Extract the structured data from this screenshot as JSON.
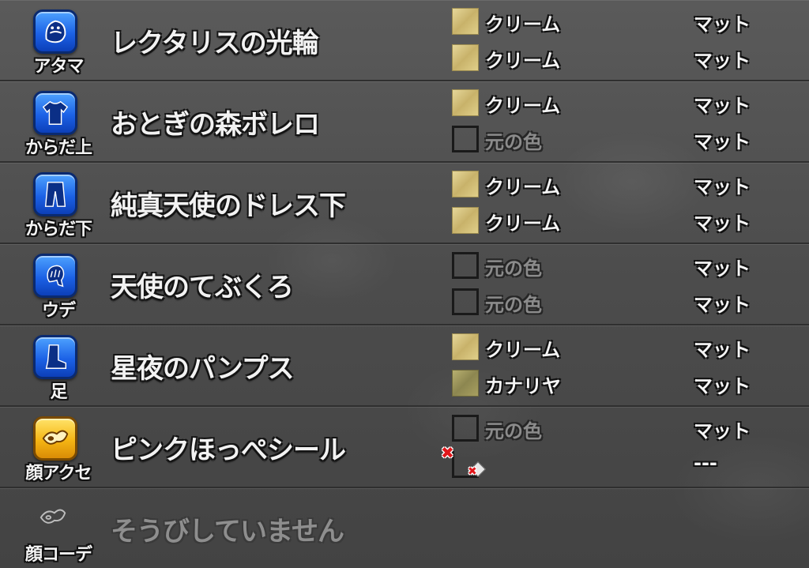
{
  "rows": [
    {
      "slot_label": "アタマ",
      "slot_icon": "helmet-icon",
      "item_name": "レクタリスの光輪",
      "dyes": [
        {
          "swatch": "cream",
          "color": "クリーム",
          "finish": "マット"
        },
        {
          "swatch": "cream",
          "color": "クリーム",
          "finish": "マット"
        }
      ]
    },
    {
      "slot_label": "からだ上",
      "slot_icon": "shirt-icon",
      "item_name": "おとぎの森ボレロ",
      "dyes": [
        {
          "swatch": "cream",
          "color": "クリーム",
          "finish": "マット"
        },
        {
          "swatch": "original",
          "color": "元の色",
          "finish": "マット"
        }
      ]
    },
    {
      "slot_label": "からだ下",
      "slot_icon": "pants-icon",
      "item_name": "純真天使のドレス下",
      "dyes": [
        {
          "swatch": "cream",
          "color": "クリーム",
          "finish": "マット"
        },
        {
          "swatch": "cream",
          "color": "クリーム",
          "finish": "マット"
        }
      ]
    },
    {
      "slot_label": "ウデ",
      "slot_icon": "glove-icon",
      "item_name": "天使のてぶくろ",
      "dyes": [
        {
          "swatch": "original",
          "color": "元の色",
          "finish": "マット"
        },
        {
          "swatch": "original",
          "color": "元の色",
          "finish": "マット"
        }
      ]
    },
    {
      "slot_label": "足",
      "slot_icon": "boot-icon",
      "item_name": "星夜のパンプス",
      "dyes": [
        {
          "swatch": "cream",
          "color": "クリーム",
          "finish": "マット"
        },
        {
          "swatch": "canary",
          "color": "カナリヤ",
          "finish": "マット"
        }
      ]
    },
    {
      "slot_label": "顔アクセ",
      "slot_icon": "face-accessory-icon",
      "item_name": "ピンクほっぺシール",
      "dyes": [
        {
          "swatch": "original",
          "color": "元の色",
          "finish": "マット"
        },
        {
          "swatch": "unavailable",
          "color": "",
          "finish": "---"
        }
      ]
    },
    {
      "slot_label": "顔コーデ",
      "slot_icon": "face-coordinate-icon",
      "item_name": "そうびしていません",
      "dyes": []
    }
  ]
}
